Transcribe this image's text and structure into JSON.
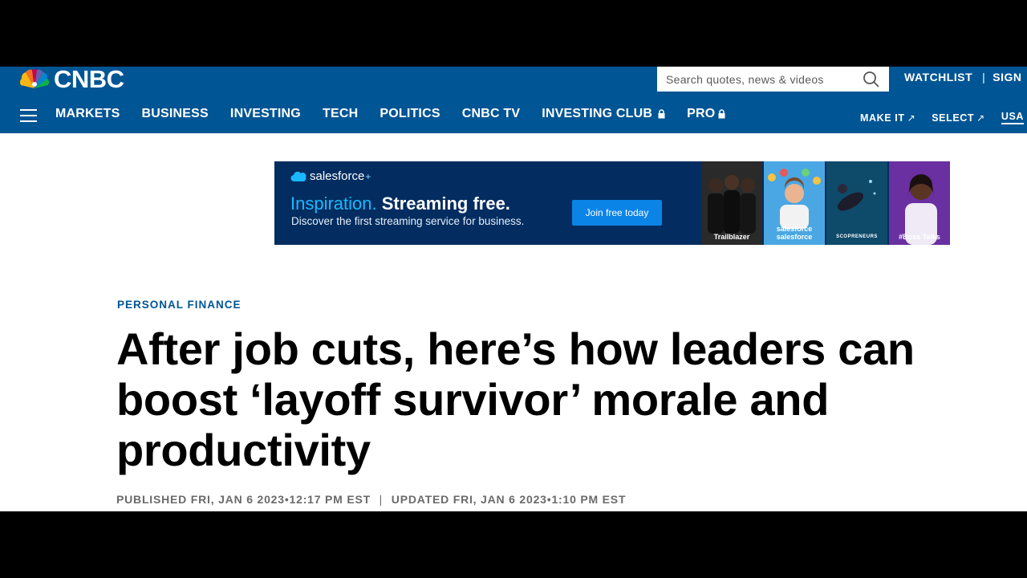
{
  "header": {
    "logo_text": "CNBC",
    "search_placeholder": "Search quotes, news & videos",
    "top_links": [
      "WATCHLIST",
      "SIGN"
    ],
    "nav_items": [
      "MARKETS",
      "BUSINESS",
      "INVESTING",
      "TECH",
      "POLITICS",
      "CNBC TV",
      "INVESTING CLUB",
      "PRO"
    ],
    "nav_right": [
      "MAKE IT",
      "SELECT",
      "USA"
    ],
    "colors": {
      "header_bg": "#005594",
      "text": "#ffffff"
    }
  },
  "ad": {
    "brand": "salesforce",
    "headline_accent": "Inspiration.",
    "headline_main": "Streaming free.",
    "subtext": "Discover the first streaming service for business.",
    "cta": "Join free today",
    "tiles": [
      {
        "label": "Trailblazer",
        "bg": "#1b1b1b"
      },
      {
        "label": "salesforce salesforce",
        "bg": "#3aa0e0"
      },
      {
        "label": "SCOPRENEURS",
        "bg": "#0c3f5c"
      },
      {
        "label": "#Boss Talks",
        "bg": "#5b2a8f"
      }
    ],
    "colors": {
      "bg": "#032d60",
      "accent": "#1ab9ff",
      "cta_bg": "#0b84e8"
    }
  },
  "article": {
    "section": "PERSONAL FINANCE",
    "headline": "After job cuts, here’s how leaders can boost ‘layoff survivor’ morale and productivity",
    "published": "PUBLISHED FRI, JAN 6 2023•12:17 PM EST",
    "separator": "|",
    "updated": "UPDATED FRI, JAN 6 2023•1:10 PM EST"
  }
}
